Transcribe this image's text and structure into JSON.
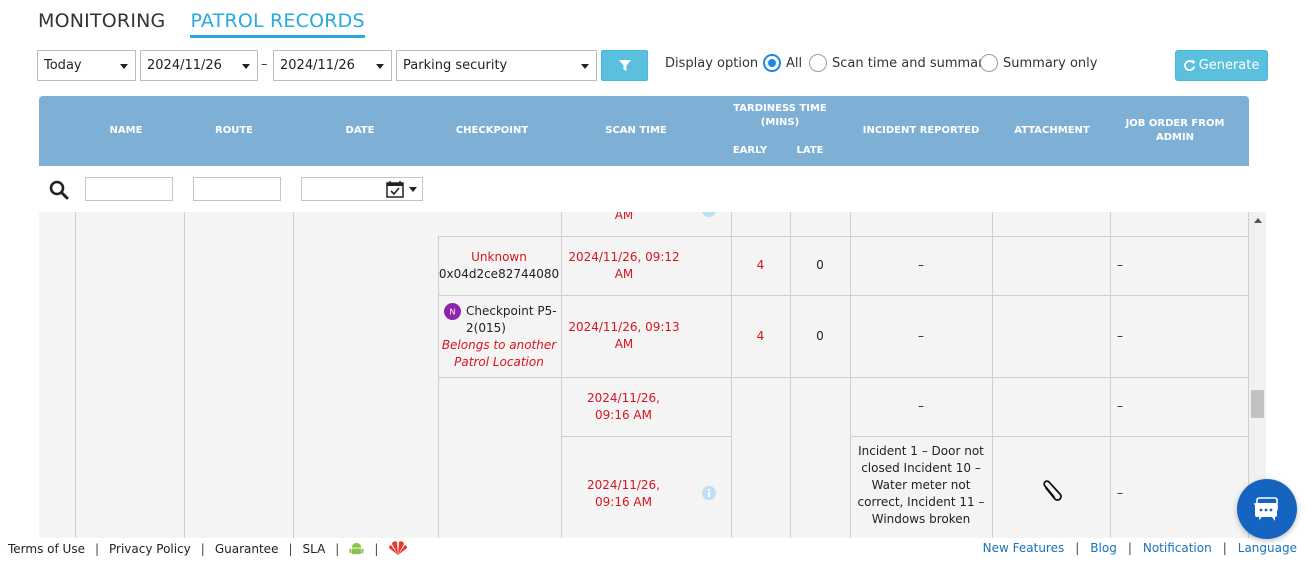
{
  "tabs": [
    {
      "label": "MONITORING",
      "active": false
    },
    {
      "label": "PATROL RECORDS",
      "active": true
    }
  ],
  "toolbar": {
    "period": "Today",
    "date_from": "2024/11/26",
    "date_sep": "–",
    "date_to": "2024/11/26",
    "location": "Parking security",
    "display_label": "Display option",
    "options": [
      {
        "label": "All",
        "selected": true
      },
      {
        "label": "Scan time and summary",
        "selected": false
      },
      {
        "label": "Summary only",
        "selected": false
      }
    ],
    "generate_label": "Generate"
  },
  "table": {
    "headers": {
      "name": "NAME",
      "route": "ROUTE",
      "date": "DATE",
      "checkpoint": "CHECKPOINT",
      "scan_time": "SCAN TIME",
      "tardiness": "TARDINESS TIME (MINS)",
      "early": "EARLY",
      "late": "LATE",
      "incident": "INCIDENT REPORTED",
      "attachment": "ATTACHMENT",
      "job_order": "JOB ORDER FROM ADMIN"
    },
    "rows": {
      "partial_scan": "AM",
      "r1": {
        "checkpoint_status": "Unknown",
        "checkpoint_id": "0x04d2ce82744080",
        "scan_time": "2024/11/26, 09:12 AM",
        "early": "4",
        "late": "0",
        "incident": "–",
        "job": "–"
      },
      "r2": {
        "checkpoint_name": "Checkpoint P5-2(015)",
        "checkpoint_note": "Belongs to another Patrol Location",
        "scan_time": "2024/11/26, 09:13 AM",
        "early": "4",
        "late": "0",
        "incident": "–",
        "job": "–"
      },
      "r3a": {
        "scan_time": "2024/11/26, 09:16 AM",
        "incident": "–",
        "job": "–"
      },
      "r3b": {
        "scan_time": "2024/11/26, 09:16 AM",
        "incident": "Incident 1 – Door not closed Incident 10 – Water meter not correct, Incident 11 – Windows broken",
        "job": "–"
      }
    }
  },
  "footer": {
    "left": [
      "Terms of Use",
      "Privacy Policy",
      "Guarantee",
      "SLA"
    ],
    "right": [
      "New Features",
      "Blog",
      "Notification",
      "Language"
    ]
  },
  "colors": {
    "accent": "#28aadf",
    "header_bg": "#7eb0d5",
    "alert_red": "#d9141e",
    "link_blue": "#1a73b8",
    "chat_blue": "#1565c0"
  },
  "icons": [
    "filter-icon",
    "refresh-icon",
    "search-icon",
    "calendar-icon",
    "nfc-icon",
    "info-icon",
    "paperclip-icon",
    "android-icon",
    "huawei-icon",
    "chat-icon"
  ]
}
